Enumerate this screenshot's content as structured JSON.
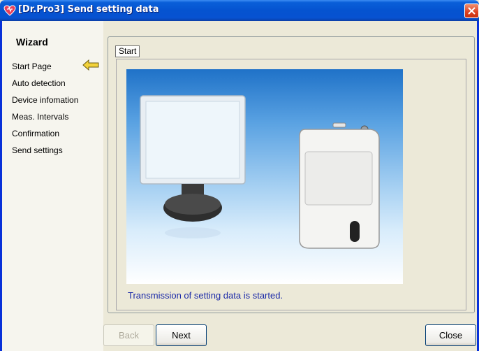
{
  "window": {
    "title": "[Dr.Pro3] Send setting data"
  },
  "sidebar": {
    "title": "Wizard",
    "items": [
      {
        "label": "Start Page",
        "current": true
      },
      {
        "label": "Auto detection"
      },
      {
        "label": "Device infomation"
      },
      {
        "label": "Meas. Intervals"
      },
      {
        "label": "Confirmation"
      },
      {
        "label": "Send settings"
      }
    ],
    "current_icon": "arrow-left-icon"
  },
  "main": {
    "tab_label": "Start",
    "image": "monitor-and-device-illustration",
    "message": "Transmission of setting data is started."
  },
  "buttons": {
    "back": {
      "label": "Back",
      "enabled": false
    },
    "next": {
      "label": "Next",
      "enabled": true
    },
    "close": {
      "label": "Close",
      "enabled": true
    }
  },
  "colors": {
    "titlebar": "#0553d0",
    "message_text": "#1b2aa8",
    "current_arrow": "#e8c020"
  }
}
